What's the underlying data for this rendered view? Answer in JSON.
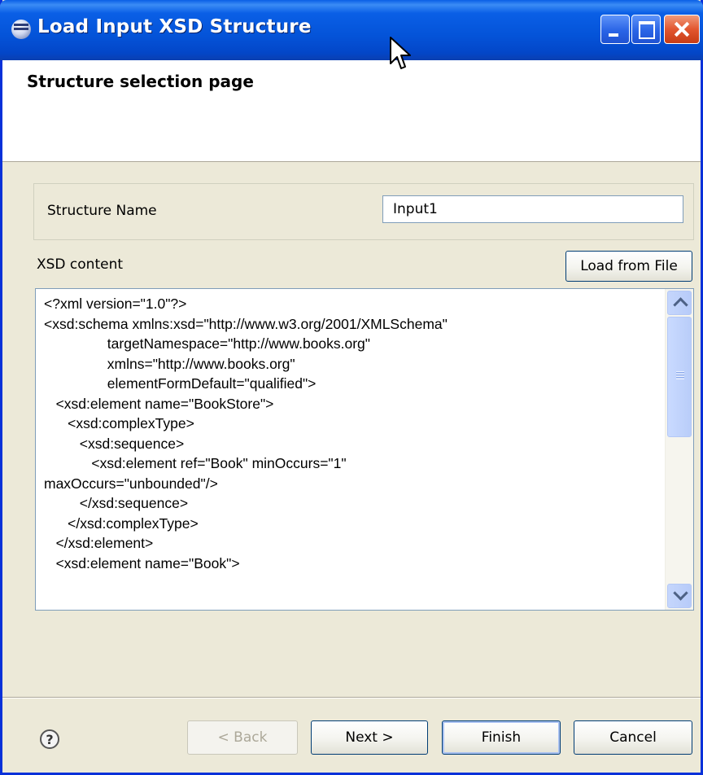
{
  "window": {
    "title": "Load Input XSD Structure"
  },
  "header": {
    "title": "Structure selection page"
  },
  "form": {
    "structure_name_label": "Structure Name",
    "structure_name_value": "Input1",
    "xsd_label": "XSD content",
    "load_button": "Load from File",
    "xsd_lines": [
      "<?xml version=\"1.0\"?>",
      "<xsd:schema xmlns:xsd=\"http://www.w3.org/2001/XMLSchema\"",
      "                targetNamespace=\"http://www.books.org\"",
      "                xmlns=\"http://www.books.org\"",
      "                elementFormDefault=\"qualified\">",
      "   <xsd:element name=\"BookStore\">",
      "      <xsd:complexType>",
      "         <xsd:sequence>",
      "            <xsd:element ref=\"Book\" minOccurs=\"1\"",
      "maxOccurs=\"unbounded\"/>",
      "         </xsd:sequence>",
      "      </xsd:complexType>",
      "   </xsd:element>",
      "   <xsd:element name=\"Book\">"
    ]
  },
  "footer": {
    "back": "< Back",
    "next": "Next >",
    "finish": "Finish",
    "cancel": "Cancel",
    "help": "?"
  },
  "colors": {
    "titlebar": "#0453d8",
    "dialog_bg": "#ece9d8",
    "border": "#0831d9"
  }
}
